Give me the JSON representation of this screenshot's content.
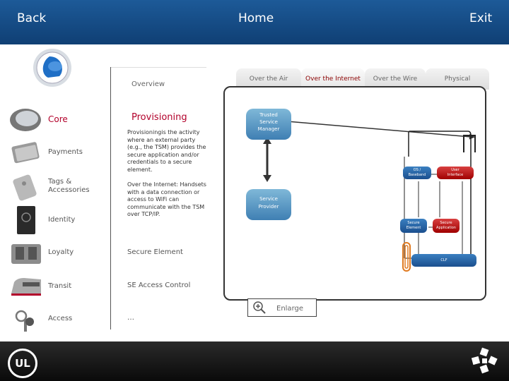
{
  "nav": {
    "back": "Back",
    "home": "Home",
    "exit": "Exit"
  },
  "logo": "UL",
  "menu": {
    "items": [
      {
        "label": "Core",
        "icon": "phone-icon"
      },
      {
        "label": "Payments",
        "icon": "money-icon"
      },
      {
        "label": "Tags &\nAccessories",
        "icon": "tag-icon"
      },
      {
        "label": "Identity",
        "icon": "passport-icon"
      },
      {
        "label": "Loyalty",
        "icon": "cards-icon"
      },
      {
        "label": "Transit",
        "icon": "train-icon"
      },
      {
        "label": "Access",
        "icon": "keys-icon"
      }
    ]
  },
  "content": {
    "overview": "Overview",
    "title": "Provisioning",
    "para1": "Provisioningis the activity where an external party (e.g., the TSM) provides the secure application and/or credentials to a secure element.",
    "para2": "Over the Internet: Handsets with a data connection or access to WiFi can communicate with the TSM over TCP/IP.",
    "links": [
      "Secure Element",
      "SE Access Control",
      "…"
    ]
  },
  "diagram": {
    "tabs": [
      "Over the Air",
      "Over the Internet",
      "Over the Wire",
      "Physical"
    ],
    "active_tab": "Over the Internet",
    "tsm": "Trusted\nService\nManager",
    "sp": "Service\nProvider",
    "os": "OS /\nBaseband",
    "ui": "User\nInterface",
    "se": "Secure\nElement",
    "sa": "Secure\nApplication",
    "clf": "CLF",
    "enlarge": "Enlarge"
  },
  "colors": {
    "accent": "#b2002a",
    "topbar": "#1b5190"
  }
}
